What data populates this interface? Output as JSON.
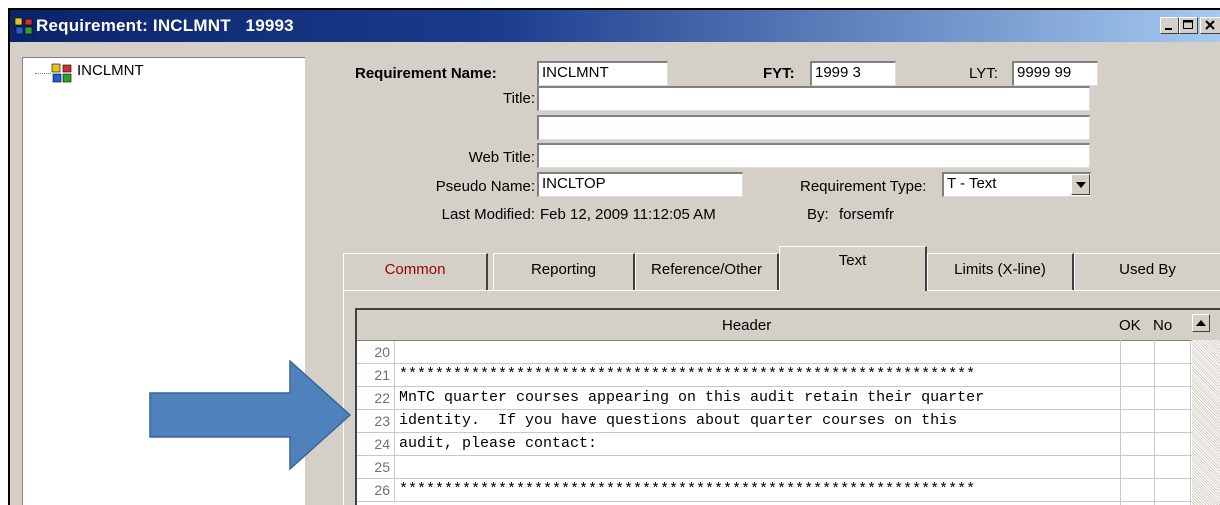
{
  "window": {
    "title": "Requirement: INCLMNT   19993",
    "controls": [
      "minimize-icon",
      "maximize-icon",
      "close-icon"
    ]
  },
  "tree": {
    "items": [
      {
        "label": "INCLMNT",
        "icon": "requirement-node-icon"
      }
    ]
  },
  "form": {
    "requirement_name_label": "Requirement Name:",
    "requirement_name_value": "INCLMNT",
    "fyt_label": "FYT:",
    "fyt_value": "1999 3",
    "lyt_label": "LYT:",
    "lyt_value": "9999 99",
    "title_label": "Title:",
    "title_value_1": "",
    "title_value_2": "",
    "web_title_label": "Web Title:",
    "web_title_value": "",
    "pseudo_name_label": "Pseudo Name:",
    "pseudo_name_value": "INCLTOP",
    "requirement_type_label": "Requirement Type:",
    "requirement_type_value": "T - Text",
    "last_modified_label": "Last Modified:",
    "last_modified_value": "Feb 12, 2009  11:12:05 AM",
    "by_label": "By:",
    "by_value": "forsemfr"
  },
  "tabs": [
    {
      "label": "Common"
    },
    {
      "label": "Reporting"
    },
    {
      "label": "Reference/Other"
    },
    {
      "label": "Text"
    },
    {
      "label": "Limits (X-line)"
    },
    {
      "label": "Used By"
    }
  ],
  "active_tab": "Text",
  "text_grid": {
    "header": "Header",
    "ok_label": "OK",
    "no_label": "No",
    "rows": [
      {
        "num": "20",
        "text": ""
      },
      {
        "num": "21",
        "text": "****************************************************************"
      },
      {
        "num": "22",
        "text": "MnTC quarter courses appearing on this audit retain their quarter"
      },
      {
        "num": "23",
        "text": "identity.  If you have questions about quarter courses on this"
      },
      {
        "num": "24",
        "text": "audit, please contact:"
      },
      {
        "num": "25",
        "text": ""
      },
      {
        "num": "26",
        "text": "****************************************************************"
      }
    ]
  },
  "colors": {
    "titlebar_start": "#0a246a",
    "titlebar_end": "#a6caf0",
    "window_face": "#d4d0c8",
    "arrow_fill": "#4f81bd",
    "common_tab_text": "#990000"
  }
}
